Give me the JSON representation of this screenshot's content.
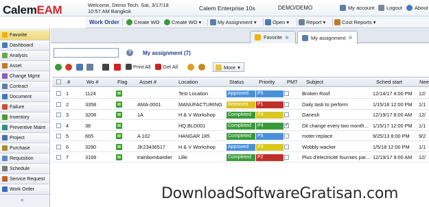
{
  "header": {
    "logo_main": "Calem",
    "logo_accent": "EAM",
    "welcome_line1": "Welcome, Demo Tech. Sat, 3/17/18",
    "welcome_line2": "10:57 AM Bangkok",
    "product": "Calem Enterprise 10s",
    "user": "DEMO/DEMO",
    "my_account": "My account",
    "logout": "Logout",
    "about": "About"
  },
  "toolbar": {
    "title": "Work Order",
    "create_wo": "Create WO",
    "create_wo_menu": "Create WO",
    "my_assignment": "My Assignment",
    "open": "Open",
    "report": "Report",
    "cost_reports": "Cost Reports"
  },
  "sidebar": {
    "items": [
      {
        "label": "Favorite",
        "icon": "star-icon",
        "color": "#f0b400"
      },
      {
        "label": "Dashboard",
        "icon": "dashboard-icon",
        "color": "#4a79b8"
      },
      {
        "label": "Analysis",
        "icon": "analysis-icon",
        "color": "#6aa84f"
      },
      {
        "label": "Asset",
        "icon": "asset-icon",
        "color": "#c07a2a"
      },
      {
        "label": "Change Mgmt",
        "icon": "change-icon",
        "color": "#8a5bb8"
      },
      {
        "label": "Contract",
        "icon": "contract-icon",
        "color": "#5b7fa8"
      },
      {
        "label": "Document",
        "icon": "document-icon",
        "color": "#3d7bbf"
      },
      {
        "label": "Failure",
        "icon": "failure-icon",
        "color": "#d24b2a"
      },
      {
        "label": "Inventory",
        "icon": "inventory-icon",
        "color": "#4e9a3a"
      },
      {
        "label": "Preventive Maint",
        "icon": "preventive-icon",
        "color": "#2f8f8a"
      },
      {
        "label": "Project",
        "icon": "project-icon",
        "color": "#4a6fb0"
      },
      {
        "label": "Purchase",
        "icon": "purchase-icon",
        "color": "#b08a2a"
      },
      {
        "label": "Requisition",
        "icon": "requisition-icon",
        "color": "#5a8abf"
      },
      {
        "label": "Schedule",
        "icon": "schedule-icon",
        "color": "#7a7a7a"
      },
      {
        "label": "Service Request",
        "icon": "service-icon",
        "color": "#c0602a"
      },
      {
        "label": "Work Order",
        "icon": "workorder-icon",
        "color": "#3a6fb5"
      }
    ]
  },
  "tabs": [
    {
      "label": "Favorite"
    },
    {
      "label": "My assignment"
    }
  ],
  "list": {
    "search_value": "",
    "help": "?",
    "title": "My assignment (7)",
    "print_all": "Print All",
    "get_all": "Get All",
    "more": "More"
  },
  "columns": [
    "#",
    "Wo #",
    "Flag",
    "Asset #",
    "Location",
    "Status",
    "Priority",
    "PM?",
    "Subject",
    "Sched start",
    "Nee"
  ],
  "rows": [
    {
      "n": "1",
      "wo": "1124",
      "asset": "",
      "location": "Test Location",
      "status": "Approved",
      "status_color": "#4a90d9",
      "priority": "P5",
      "prio_color": "#4a90d9",
      "pm": false,
      "subject": "Broken Roof",
      "sched": "12/14/17 4:00 PM",
      "need": "12/"
    },
    {
      "n": "2",
      "wo": "3358",
      "asset": "AMA-0001",
      "location": "MANUFACTURING",
      "status": "Released",
      "status_color": "#e0c020",
      "priority": "P1",
      "prio_color": "#c0302a",
      "pm": false,
      "subject": "Daily task to perform",
      "sched": "1/15/18 12:00 PM",
      "need": "1/1"
    },
    {
      "n": "3",
      "wo": "3208",
      "asset": "1A",
      "location": "H & V Workshop",
      "status": "Completed",
      "status_color": "#3a9a3a",
      "priority": "P3",
      "prio_color": "#d8c820",
      "pm": false,
      "subject": "Ganesh",
      "sched": "12/19/17 8:00 AM",
      "need": "12/"
    },
    {
      "n": "4",
      "wo": "38",
      "asset": "",
      "location": "HQ.BLD001",
      "status": "Completed",
      "status_color": "#3a9a3a",
      "priority": "P4",
      "prio_color": "#3a9a3a",
      "pm": true,
      "subject": "Oil change every two month...",
      "sched": "1/15/17 12:00 PM",
      "need": "1/1"
    },
    {
      "n": "5",
      "wo": "665",
      "asset": "A 102",
      "location": "HANGAR 185",
      "status": "Completed",
      "status_color": "#3a9a3a",
      "priority": "P5",
      "prio_color": "#4a90d9",
      "pm": false,
      "subject": "moter replace",
      "sched": "9/25/13 8:00 PM",
      "need": "9/2"
    },
    {
      "n": "6",
      "wo": "3280",
      "asset": "JK23436517",
      "location": "H & V Workshop",
      "status": "Approved",
      "status_color": "#4a90d9",
      "priority": "P3",
      "prio_color": "#d8c820",
      "pm": false,
      "subject": "Wobbly wacker",
      "sched": "1/5/18 12:00 PM",
      "need": "1/1"
    },
    {
      "n": "7",
      "wo": "3169",
      "asset": "trainbombardier",
      "location": "Lille",
      "status": "Completed",
      "status_color": "#3a9a3a",
      "priority": "P2",
      "prio_color": "#c0302a",
      "pm": false,
      "subject": "Plus d'electricité fournies par...",
      "sched": "12/19/17 9:00 AM",
      "need": "12/"
    }
  ],
  "watermark": "DownloadSoftwareGratisan.com"
}
